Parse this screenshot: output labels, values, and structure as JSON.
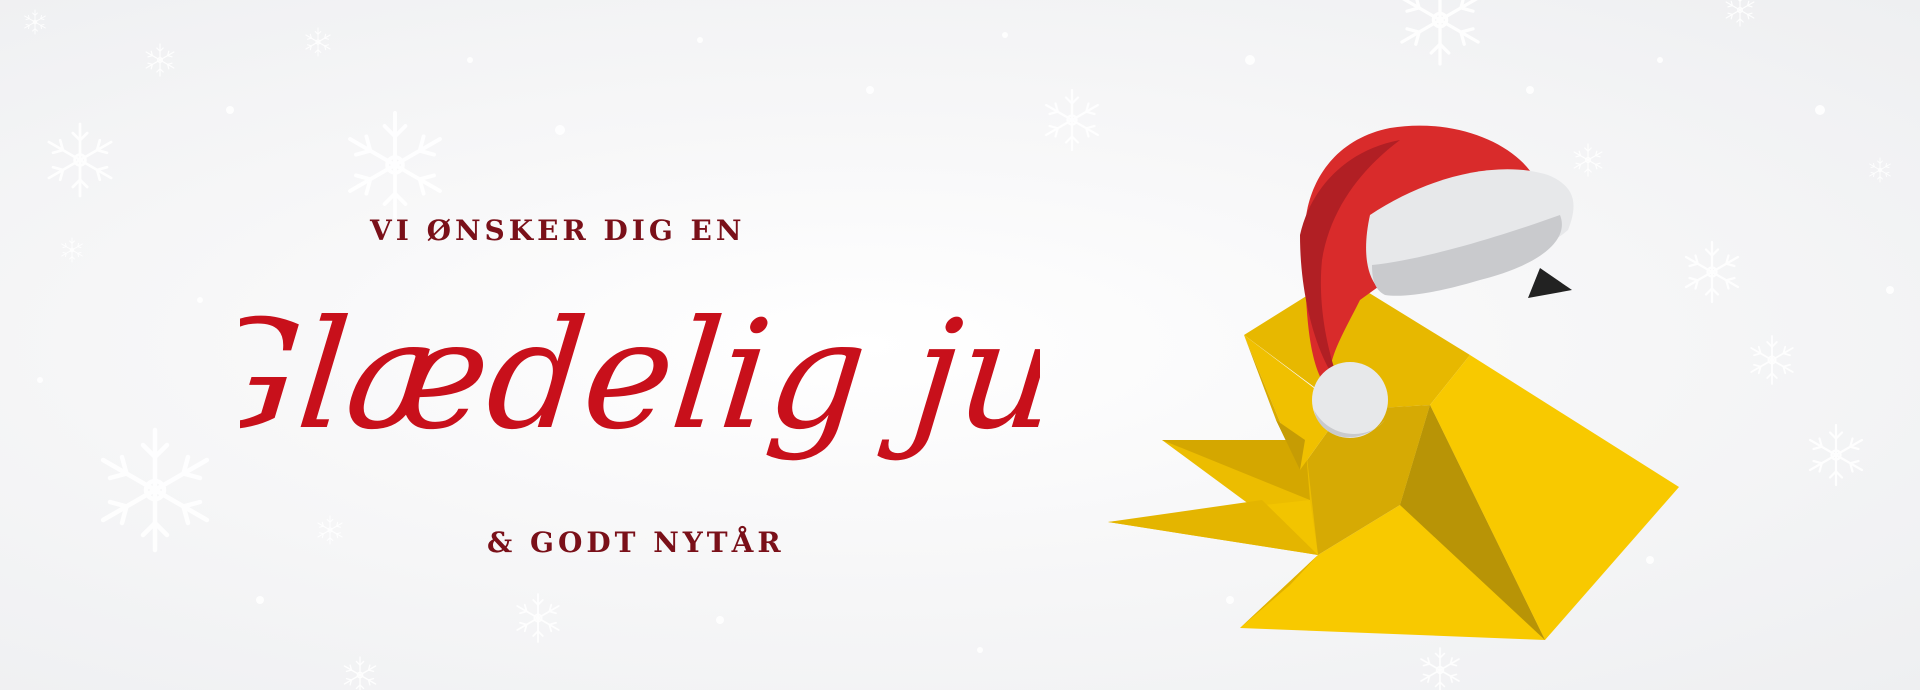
{
  "greeting": {
    "line_top": "VI ØNSKER DIG EN",
    "headline": "Glædelig jul",
    "line_bottom": "& GODT NYTÅR"
  },
  "colors": {
    "headline_red": "#c8101b",
    "subtext_maroon": "#7a1019",
    "bird_yellow": "#f2c400",
    "bird_dark": "#b89406",
    "hat_red": "#d92b2b",
    "hat_fur": "#e6e7e9",
    "background": "#f4f4f6"
  },
  "illustration": {
    "icon": "origami-bird-with-santa-hat-icon",
    "snow_icon": "snowflake-icon"
  }
}
